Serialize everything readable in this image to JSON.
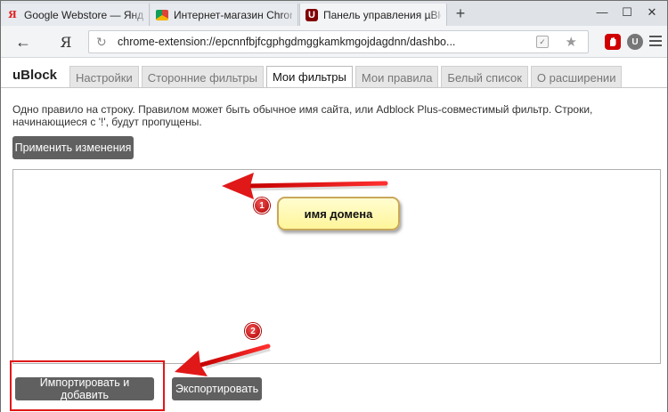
{
  "browser": {
    "tabs": [
      {
        "label": "Google Webstore — Яндекс",
        "icon": "yandex-icon"
      },
      {
        "label": "Интернет-магазин Chrome",
        "icon": "chrome-store-icon"
      },
      {
        "label": "Панель управления µBlock",
        "icon": "ublock-icon"
      }
    ],
    "new_tab": "+",
    "window_controls": {
      "minimize": "—",
      "maximize": "☐",
      "close": "✕"
    },
    "back": "←",
    "home_label": "Я",
    "url": "chrome-extension://epcnnfbjfcgphgdmggkamkmgojdagdnn/dashbo..."
  },
  "app": {
    "brand": "uBlock",
    "nav_tabs": [
      "Настройки",
      "Сторонние фильтры",
      "Мои фильтры",
      "Мои правила",
      "Белый список",
      "О расширении"
    ],
    "selected_tab": "Мои фильтры",
    "description": "Одно правило на строку. Правилом может быть обычное имя сайта, или Adblock Plus-совместимый фильтр. Строки, начинающиеся с '!', будут пропущены.",
    "apply_button": "Применить изменения",
    "editor_value": "",
    "import_button": "Импортировать и добавить",
    "export_button": "Экспортировать"
  },
  "annotations": {
    "marker_1": "1",
    "marker_2": "2",
    "callout_text": "имя домена",
    "accent_color": "#e01818"
  }
}
